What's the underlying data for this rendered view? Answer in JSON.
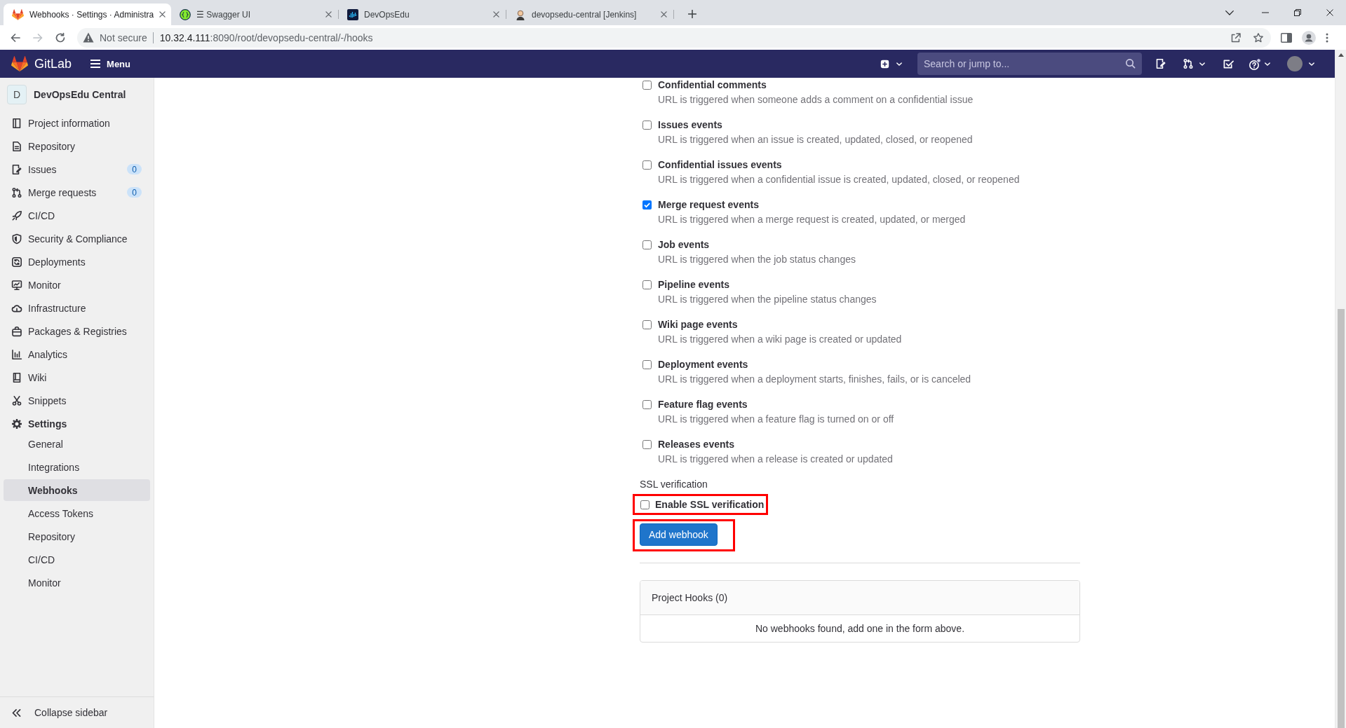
{
  "browser": {
    "tabs": [
      {
        "title": "Webhooks · Settings · Administra",
        "selected": true
      },
      {
        "title": "☰ Swagger UI",
        "selected": false
      },
      {
        "title": "DevOpsEdu",
        "selected": false
      },
      {
        "title": "devopsedu-central [Jenkins]",
        "selected": false
      }
    ],
    "navigation": {
      "back_disabled": false,
      "forward_disabled": true
    },
    "security_label": "Not secure",
    "address": {
      "host": "10.32.4.111",
      "path": ":8090/root/devopsedu-central/-/hooks"
    }
  },
  "header": {
    "brand": "GitLab",
    "menu_label": "Menu",
    "search": {
      "placeholder": "Search or jump to..."
    }
  },
  "sidebar": {
    "project": {
      "initial": "D",
      "name": "DevOpsEdu Central"
    },
    "items": [
      {
        "label": "Project information",
        "selected": false
      },
      {
        "label": "Repository",
        "selected": false
      },
      {
        "label": "Issues",
        "selected": false,
        "badge": "0"
      },
      {
        "label": "Merge requests",
        "selected": false,
        "badge": "0"
      },
      {
        "label": "CI/CD",
        "selected": false
      },
      {
        "label": "Security & Compliance",
        "selected": false
      },
      {
        "label": "Deployments",
        "selected": false
      },
      {
        "label": "Monitor",
        "selected": false
      },
      {
        "label": "Infrastructure",
        "selected": false
      },
      {
        "label": "Packages & Registries",
        "selected": false
      },
      {
        "label": "Analytics",
        "selected": false
      },
      {
        "label": "Wiki",
        "selected": false
      },
      {
        "label": "Snippets",
        "selected": false
      },
      {
        "label": "Settings",
        "selected": true,
        "children": [
          {
            "label": "General",
            "selected": false
          },
          {
            "label": "Integrations",
            "selected": false
          },
          {
            "label": "Webhooks",
            "selected": true
          },
          {
            "label": "Access Tokens",
            "selected": false
          },
          {
            "label": "Repository",
            "selected": false
          },
          {
            "label": "CI/CD",
            "selected": false
          },
          {
            "label": "Monitor",
            "selected": false
          }
        ]
      }
    ],
    "collapse_label": "Collapse sidebar"
  },
  "events": [
    {
      "label": "Confidential comments",
      "description": "URL is triggered when someone adds a comment on a confidential issue",
      "checked": false
    },
    {
      "label": "Issues events",
      "description": "URL is triggered when an issue is created, updated, closed, or reopened",
      "checked": false
    },
    {
      "label": "Confidential issues events",
      "description": "URL is triggered when a confidential issue is created, updated, closed, or reopened",
      "checked": false
    },
    {
      "label": "Merge request events",
      "description": "URL is triggered when a merge request is created, updated, or merged",
      "checked": true
    },
    {
      "label": "Job events",
      "description": "URL is triggered when the job status changes",
      "checked": false
    },
    {
      "label": "Pipeline events",
      "description": "URL is triggered when the pipeline status changes",
      "checked": false
    },
    {
      "label": "Wiki page events",
      "description": "URL is triggered when a wiki page is created or updated",
      "checked": false
    },
    {
      "label": "Deployment events",
      "description": "URL is triggered when a deployment starts, finishes, fails, or is canceled",
      "checked": false
    },
    {
      "label": "Feature flag events",
      "description": "URL is triggered when a feature flag is turned on or off",
      "checked": false
    },
    {
      "label": "Releases events",
      "description": "URL is triggered when a release is created or updated",
      "checked": false
    }
  ],
  "ssl": {
    "heading": "SSL verification",
    "label": "Enable SSL verification",
    "checked": false,
    "highlighted": true
  },
  "submit": {
    "label": "Add webhook",
    "highlighted": true
  },
  "hooks_panel": {
    "title": "Project Hooks (0)",
    "empty_text": "No webhooks found, add one in the form above."
  }
}
